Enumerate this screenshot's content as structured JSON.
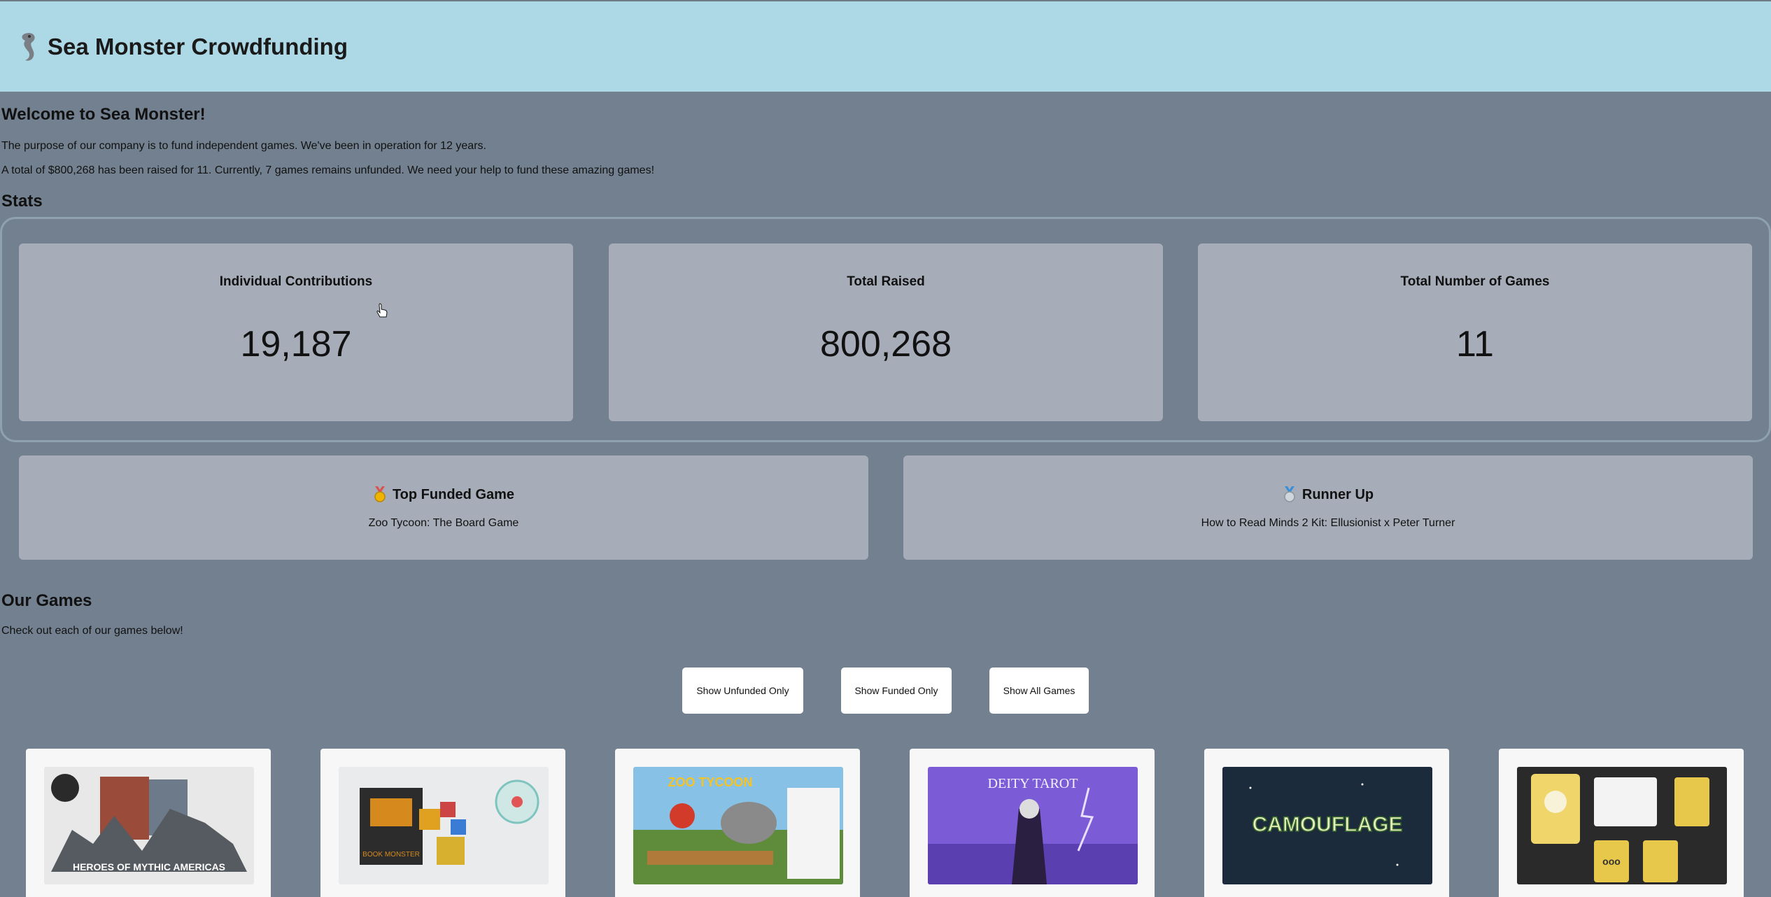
{
  "header": {
    "title": "Sea Monster Crowdfunding",
    "logo_icon": "seahorse-icon"
  },
  "intro": {
    "welcome": "Welcome to Sea Monster!",
    "purpose": "The purpose of our company is to fund independent games. We've been in operation for 12 years.",
    "summary": "A total of $800,268 has been raised for 11. Currently, 7 games remains unfunded. We need your help to fund these amazing games!"
  },
  "stats": {
    "title": "Stats",
    "cards": [
      {
        "label": "Individual Contributions",
        "value": "19,187"
      },
      {
        "label": "Total Raised",
        "value": "800,268"
      },
      {
        "label": "Total Number of Games",
        "value": "11"
      }
    ]
  },
  "top_games": {
    "top": {
      "label": "Top Funded Game",
      "name": "Zoo Tycoon: The Board Game",
      "icon": "gold-medal-icon"
    },
    "runner": {
      "label": "Runner Up",
      "name": "How to Read Minds 2 Kit: Ellusionist x Peter Turner",
      "icon": "silver-medal-icon"
    }
  },
  "games": {
    "title": "Our Games",
    "subtitle": "Check out each of our games below!",
    "buttons": {
      "unfunded": "Show Unfunded Only",
      "funded": "Show Funded Only",
      "all": "Show All Games"
    },
    "image_texts": [
      "HEROES OF MYTHIC AMERICAS",
      "BOOK MONSTER",
      "ZOO TYCOON",
      "DEITY TAROT",
      "CAMOUFLAGE",
      "ooo"
    ]
  },
  "colors": {
    "header_bg": "#add8e6",
    "page_bg": "#72808f",
    "card_bg": "#a6adb8"
  }
}
